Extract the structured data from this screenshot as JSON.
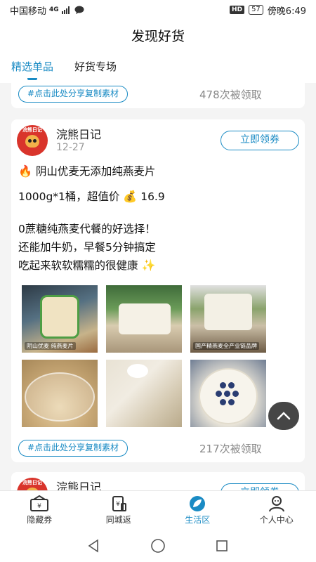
{
  "status_bar": {
    "carrier": "中国移动",
    "network": "4G",
    "hd": "HD",
    "battery": "57",
    "time": "傍晚6:49"
  },
  "header": {
    "title": "发现好货"
  },
  "tabs": [
    {
      "label": "精选单品",
      "active": true
    },
    {
      "label": "好货专场",
      "active": false
    }
  ],
  "cards": [
    {
      "share_label": "#点击此处分享复制素材",
      "claimed_text": "478次被领取"
    },
    {
      "author": "浣熊日记",
      "date": "12-27",
      "coupon_button": "立即领券",
      "lines": [
        "阴山优麦无添加纯燕麦片",
        "1000g*1桶，超值价",
        "16.9",
        "0蔗糖纯燕麦代餐的好选择！",
        "还能加牛奶，早餐5分钟搞定",
        "吃起来软软糯糯的很健康"
      ],
      "photos": [
        {
          "caption": "阴山优麦 纯燕麦片"
        },
        {
          "caption": ""
        },
        {
          "caption": "国产精燕麦全产业链品牌"
        },
        {
          "caption": ""
        },
        {
          "caption": ""
        },
        {
          "caption": ""
        }
      ],
      "share_label": "#点击此处分享复制素材",
      "claimed_text": "217次被领取"
    },
    {
      "author": "浣熊日记",
      "coupon_button": "立即领券"
    }
  ],
  "avatar_text": "浣熊日记",
  "bottom_nav": [
    {
      "label": "隐藏券",
      "icon": "ticket-icon",
      "active": false
    },
    {
      "label": "同城返",
      "icon": "receipt-icon",
      "active": false
    },
    {
      "label": "生活区",
      "icon": "leaf-icon",
      "active": true
    },
    {
      "label": "个人中心",
      "icon": "person-icon",
      "active": false
    }
  ],
  "colors": {
    "accent": "#1a8bc4",
    "background": "#f4f4f4"
  }
}
